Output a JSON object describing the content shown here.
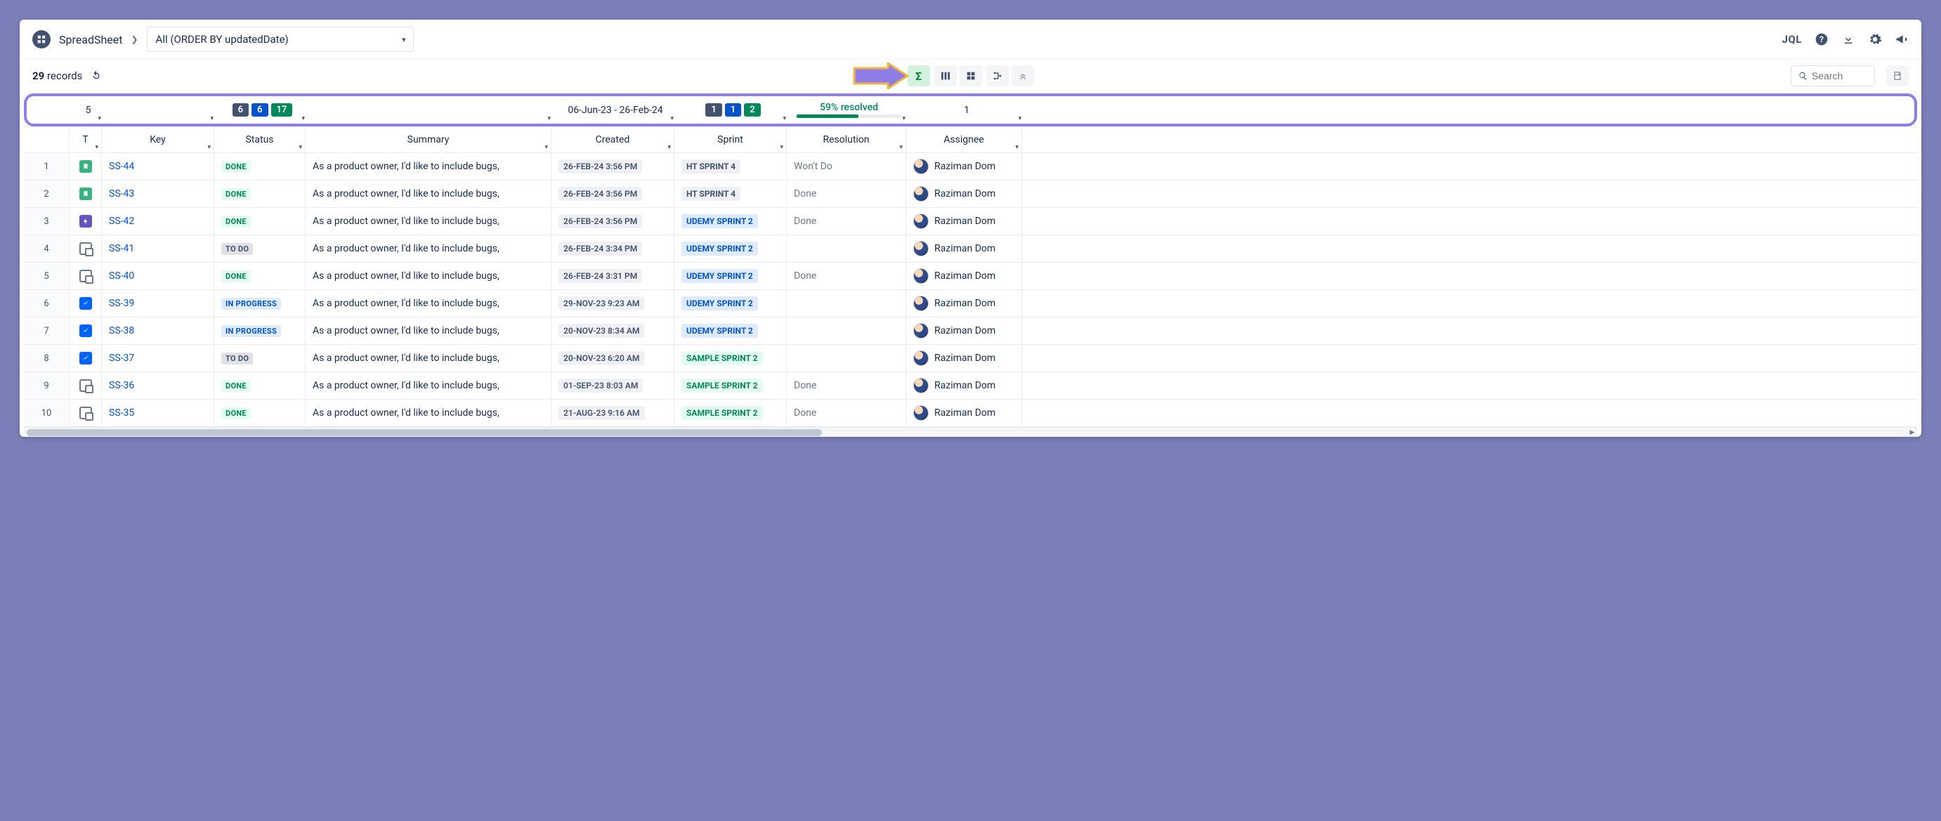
{
  "header": {
    "app_title": "SpreadSheet",
    "filter_label": "All (ORDER BY updatedDate)",
    "jql_label": "JQL"
  },
  "toolbar": {
    "records_count": "29",
    "records_label": "records",
    "search_placeholder": "Search",
    "sigma_label": "Σ"
  },
  "summary": {
    "type_count": "5",
    "status_counts": [
      "6",
      "6",
      "17"
    ],
    "created_range": "06-Jun-23 - 26-Feb-24",
    "sprint_counts": [
      "1",
      "1",
      "2"
    ],
    "resolution_pct_label": "59% resolved",
    "resolution_pct": 59,
    "assignee_count": "1"
  },
  "columns": {
    "type": "T",
    "key": "Key",
    "status": "Status",
    "summary": "Summary",
    "created": "Created",
    "sprint": "Sprint",
    "resolution": "Resolution",
    "assignee": "Assignee"
  },
  "rows": [
    {
      "num": "1",
      "type": "story",
      "key": "SS-44",
      "status": "DONE",
      "status_cls": "done",
      "summary": "As a product owner, I'd like to include bugs,",
      "created": "26-FEB-24 3:56 PM",
      "sprint": "HT SPRINT 4",
      "sprint_cls": "ht",
      "resolution": "Won't Do",
      "assignee": "Raziman Dom"
    },
    {
      "num": "2",
      "type": "story",
      "key": "SS-43",
      "status": "DONE",
      "status_cls": "done",
      "summary": "As a product owner, I'd like to include bugs,",
      "created": "26-FEB-24 3:56 PM",
      "sprint": "HT SPRINT 4",
      "sprint_cls": "ht",
      "resolution": "Done",
      "assignee": "Raziman Dom"
    },
    {
      "num": "3",
      "type": "epic",
      "key": "SS-42",
      "status": "DONE",
      "status_cls": "done",
      "summary": "As a product owner, I'd like to include bugs,",
      "created": "26-FEB-24 3:56 PM",
      "sprint": "UDEMY SPRINT 2",
      "sprint_cls": "udemy",
      "resolution": "Done",
      "assignee": "Raziman Dom"
    },
    {
      "num": "4",
      "type": "subtask",
      "key": "SS-41",
      "status": "TO DO",
      "status_cls": "todo",
      "summary": "As a product owner, I'd like to include bugs,",
      "created": "26-FEB-24 3:34 PM",
      "sprint": "UDEMY SPRINT 2",
      "sprint_cls": "udemy",
      "resolution": "",
      "assignee": "Raziman Dom"
    },
    {
      "num": "5",
      "type": "subtask",
      "key": "SS-40",
      "status": "DONE",
      "status_cls": "done",
      "summary": "As a product owner, I'd like to include bugs,",
      "created": "26-FEB-24 3:31 PM",
      "sprint": "UDEMY SPRINT 2",
      "sprint_cls": "udemy",
      "resolution": "Done",
      "assignee": "Raziman Dom"
    },
    {
      "num": "6",
      "type": "task",
      "key": "SS-39",
      "status": "IN PROGRESS",
      "status_cls": "inprogress",
      "summary": "As a product owner, I'd like to include bugs,",
      "created": "29-NOV-23 9:23 AM",
      "sprint": "UDEMY SPRINT 2",
      "sprint_cls": "udemy",
      "resolution": "",
      "assignee": "Raziman Dom"
    },
    {
      "num": "7",
      "type": "task",
      "key": "SS-38",
      "status": "IN PROGRESS",
      "status_cls": "inprogress",
      "summary": "As a product owner, I'd like to include bugs,",
      "created": "20-NOV-23 8:34 AM",
      "sprint": "UDEMY SPRINT 2",
      "sprint_cls": "udemy",
      "resolution": "",
      "assignee": "Raziman Dom"
    },
    {
      "num": "8",
      "type": "task",
      "key": "SS-37",
      "status": "TO DO",
      "status_cls": "todo",
      "summary": "As a product owner, I'd like to include bugs,",
      "created": "20-NOV-23 6:20 AM",
      "sprint": "SAMPLE SPRINT 2",
      "sprint_cls": "sample",
      "resolution": "",
      "assignee": "Raziman Dom"
    },
    {
      "num": "9",
      "type": "subtask",
      "key": "SS-36",
      "status": "DONE",
      "status_cls": "done",
      "summary": "As a product owner, I'd like to include bugs,",
      "created": "01-SEP-23 8:03 AM",
      "sprint": "SAMPLE SPRINT 2",
      "sprint_cls": "sample",
      "resolution": "Done",
      "assignee": "Raziman Dom"
    },
    {
      "num": "10",
      "type": "subtask",
      "key": "SS-35",
      "status": "DONE",
      "status_cls": "done",
      "summary": "As a product owner, I'd like to include bugs,",
      "created": "21-AUG-23 9:16 AM",
      "sprint": "SAMPLE SPRINT 2",
      "sprint_cls": "sample",
      "resolution": "Done",
      "assignee": "Raziman Dom"
    }
  ]
}
